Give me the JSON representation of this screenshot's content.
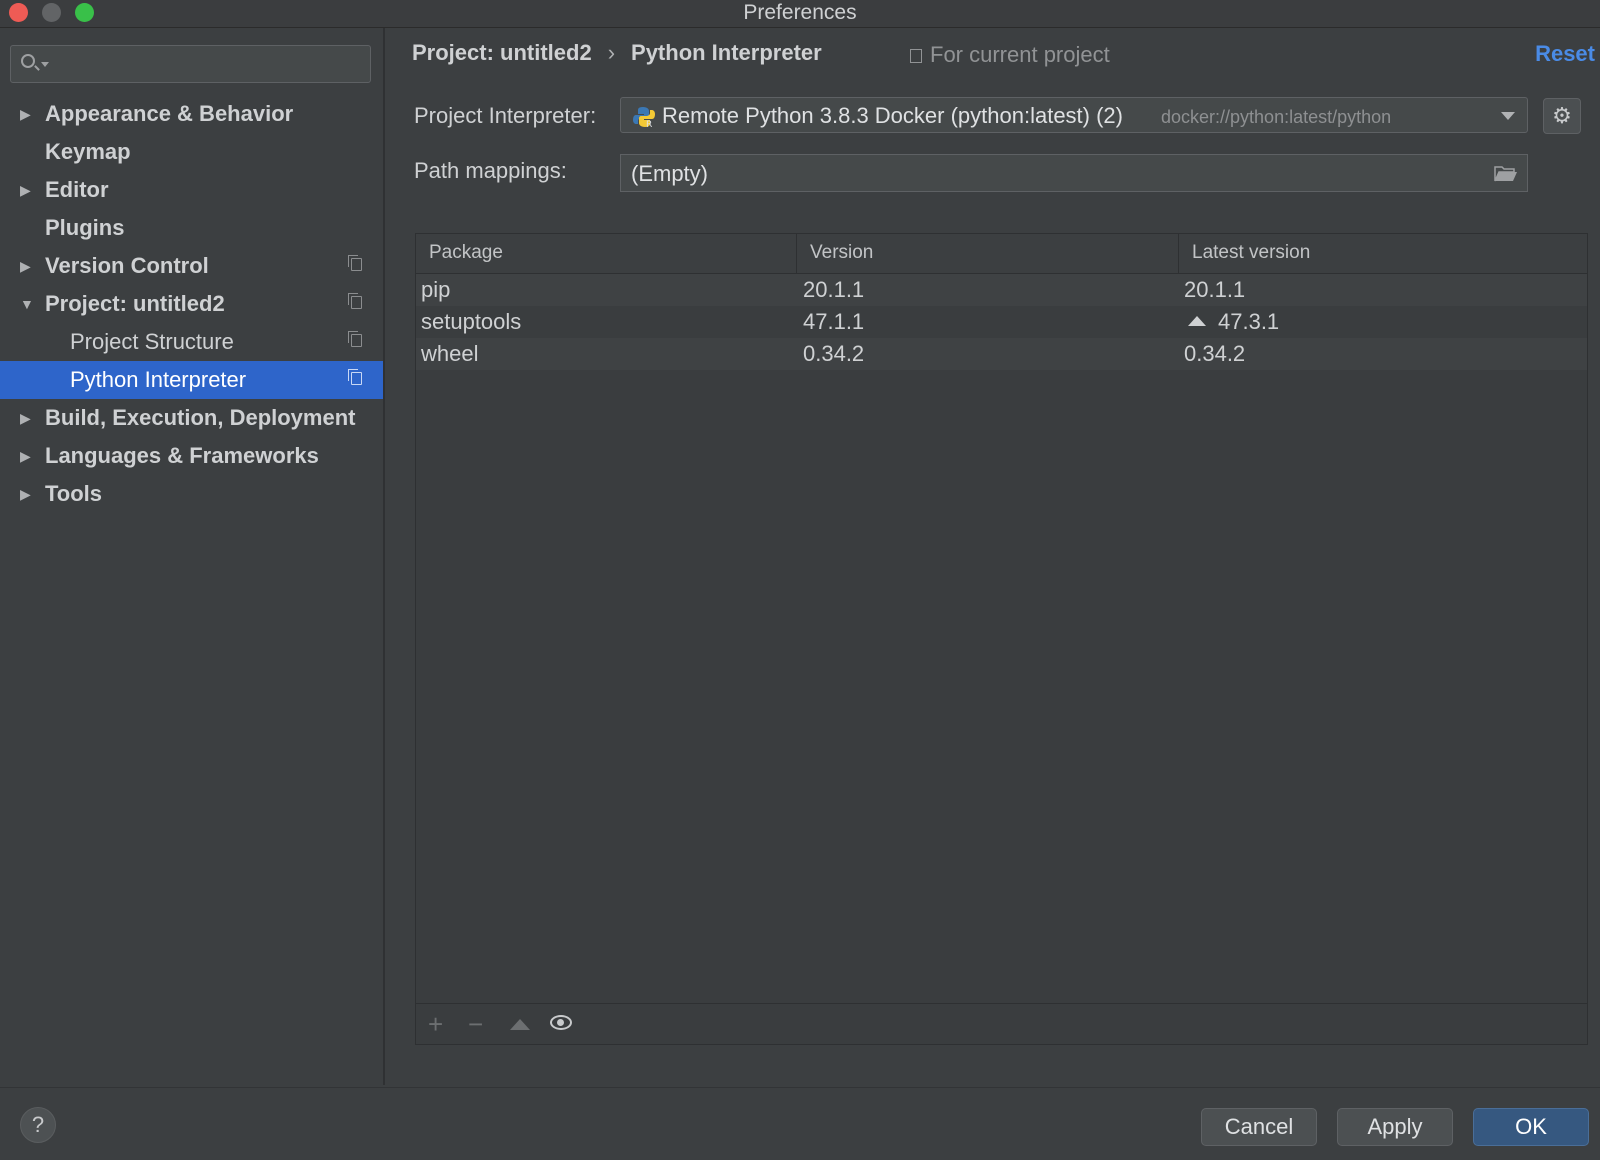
{
  "window": {
    "title": "Preferences"
  },
  "sidebar": {
    "search_placeholder": "",
    "items": [
      {
        "label": "Appearance & Behavior",
        "expandable": true,
        "expanded": false,
        "bold": true,
        "copy": false
      },
      {
        "label": "Keymap",
        "expandable": false,
        "bold": true,
        "copy": false
      },
      {
        "label": "Editor",
        "expandable": true,
        "expanded": false,
        "bold": true,
        "copy": false
      },
      {
        "label": "Plugins",
        "expandable": false,
        "bold": true,
        "copy": false
      },
      {
        "label": "Version Control",
        "expandable": true,
        "expanded": false,
        "bold": true,
        "copy": true
      },
      {
        "label": "Project: untitled2",
        "expandable": true,
        "expanded": true,
        "bold": true,
        "copy": true
      },
      {
        "label": "Project Structure",
        "level": 2,
        "copy": true
      },
      {
        "label": "Python Interpreter",
        "level": 2,
        "copy": true,
        "selected": true
      },
      {
        "label": "Build, Execution, Deployment",
        "expandable": true,
        "expanded": false,
        "bold": true,
        "copy": false
      },
      {
        "label": "Languages & Frameworks",
        "expandable": true,
        "expanded": false,
        "bold": true,
        "copy": false
      },
      {
        "label": "Tools",
        "expandable": true,
        "expanded": false,
        "bold": true,
        "copy": false
      }
    ]
  },
  "header": {
    "breadcrumb_parent": "Project: untitled2",
    "breadcrumb_sep": "›",
    "breadcrumb_current": "Python Interpreter",
    "for_current_project": "For current project",
    "reset": "Reset"
  },
  "interpreter": {
    "label": "Project Interpreter:",
    "name": "Remote Python 3.8.3 Docker (python:latest) (2)",
    "path": "docker://python:latest/python"
  },
  "path_mappings": {
    "label": "Path mappings:",
    "value": "(Empty)"
  },
  "packages": {
    "columns": [
      "Package",
      "Version",
      "Latest version"
    ],
    "rows": [
      {
        "package": "pip",
        "version": "20.1.1",
        "latest": "20.1.1",
        "upgrade": false
      },
      {
        "package": "setuptools",
        "version": "47.1.1",
        "latest": "47.3.1",
        "upgrade": true
      },
      {
        "package": "wheel",
        "version": "0.34.2",
        "latest": "0.34.2",
        "upgrade": false
      }
    ],
    "toolbar": [
      "add-icon",
      "remove-icon",
      "upgrade-icon",
      "eye-icon"
    ]
  },
  "footer": {
    "help": "?",
    "cancel": "Cancel",
    "apply": "Apply",
    "ok": "OK"
  },
  "colors": {
    "selection": "#2e65ca",
    "link": "#4a8be6",
    "default_button": "#365880"
  }
}
